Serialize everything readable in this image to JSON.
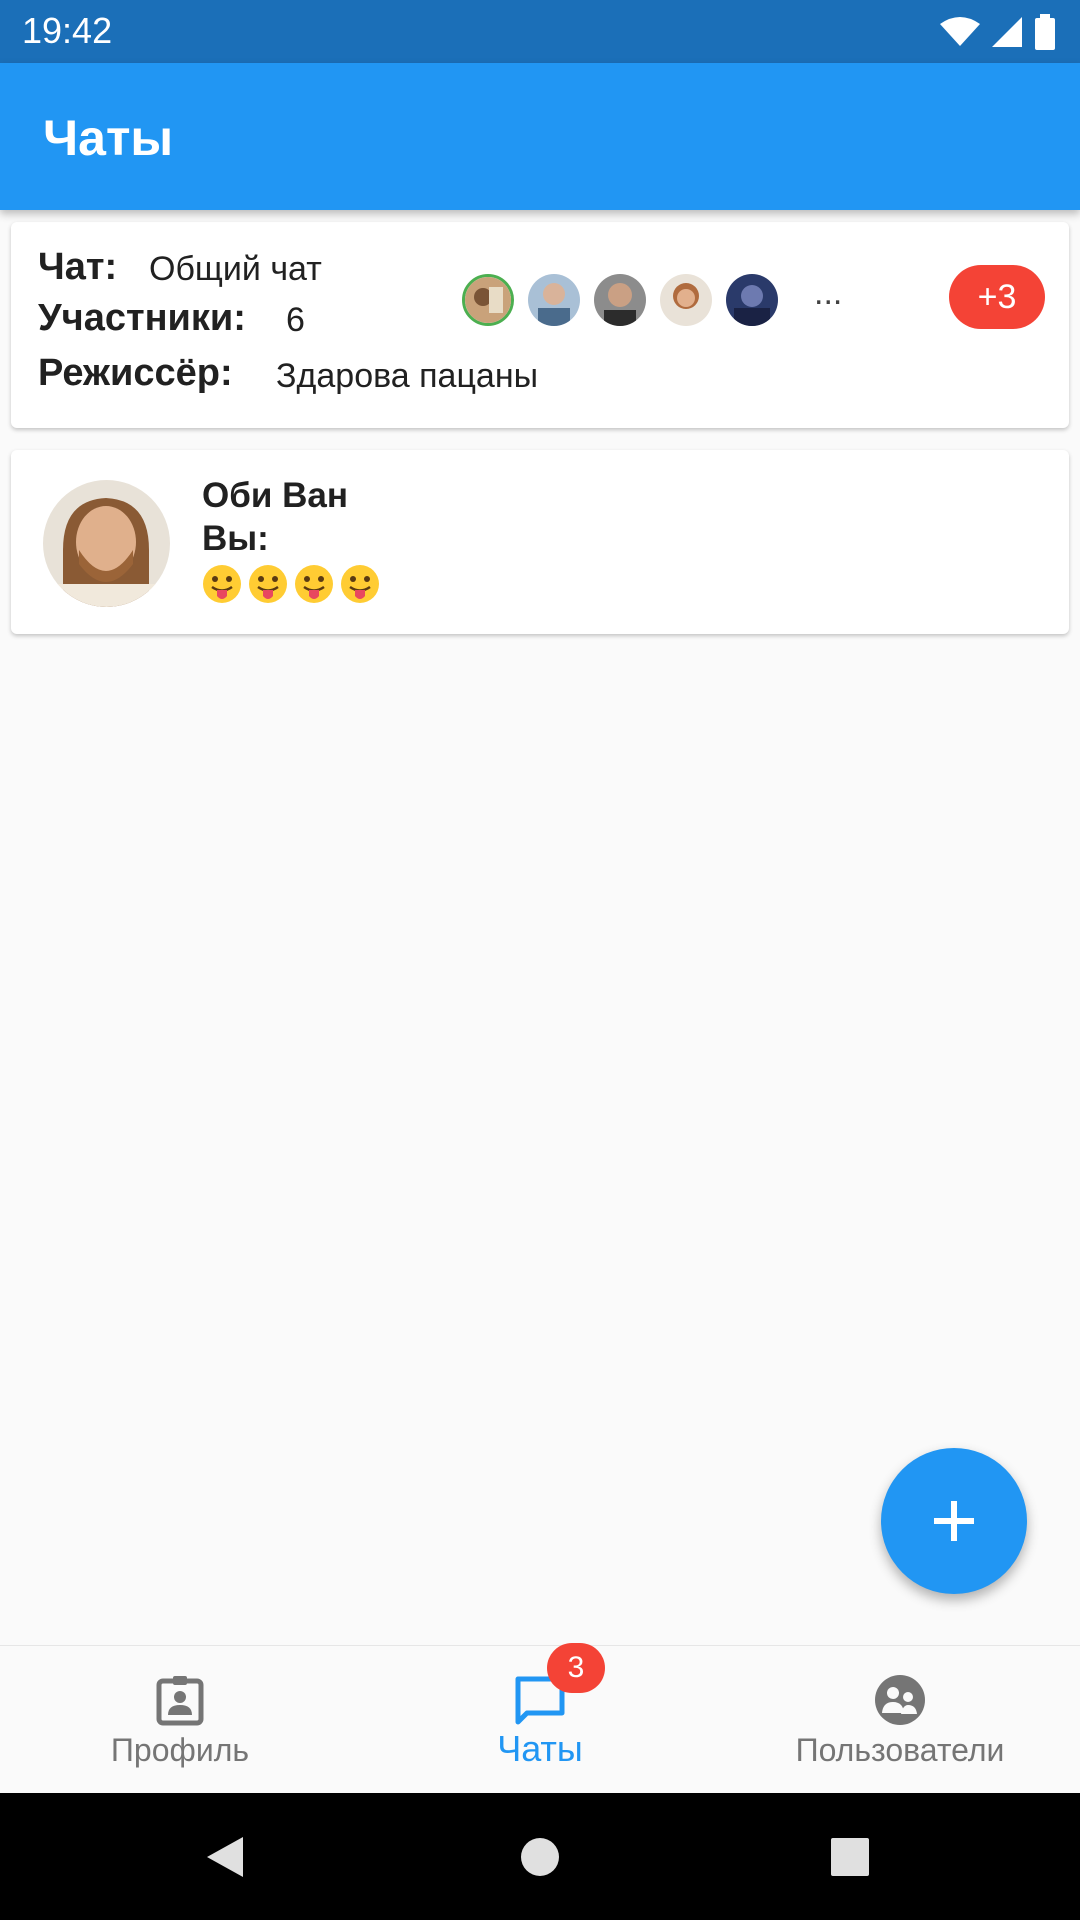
{
  "status_bar": {
    "time": "19:42",
    "icons": [
      "wifi-icon",
      "signal-icon",
      "battery-icon"
    ]
  },
  "app_bar": {
    "title": "Чаты"
  },
  "chats": {
    "group": {
      "chat_label": "Чат:",
      "chat_name": "Общий чат",
      "members_label": "Участники:",
      "members_count": "6",
      "director_label": "Режиссёр:",
      "director_text": "Здарова пацаны",
      "more_indicator": "...",
      "extra_members": "+3",
      "member_avatars": [
        "avatar-1",
        "avatar-2",
        "avatar-3",
        "avatar-4",
        "avatar-5"
      ]
    },
    "direct": {
      "name": "Оби Ван",
      "sender": "Вы:",
      "message_emojis": [
        "tongue-out-emoji",
        "tongue-out-emoji",
        "tongue-out-emoji",
        "tongue-out-emoji"
      ]
    }
  },
  "fab": {
    "icon": "plus-icon"
  },
  "bottom_nav": {
    "items": [
      {
        "label": "Профиль",
        "icon": "profile-badge-icon",
        "active": false
      },
      {
        "label": "Чаты",
        "icon": "chat-icon",
        "active": true
      },
      {
        "label": "Пользователи",
        "icon": "users-icon",
        "active": false
      }
    ],
    "chats_badge": "3"
  },
  "system_nav": {
    "icons": [
      "back-icon",
      "home-icon",
      "recents-icon"
    ]
  },
  "colors": {
    "primary": "#2196f3",
    "status_bar": "#1b6fb8",
    "badge": "#f44336",
    "background": "#fafafa",
    "inactive": "#757575"
  }
}
